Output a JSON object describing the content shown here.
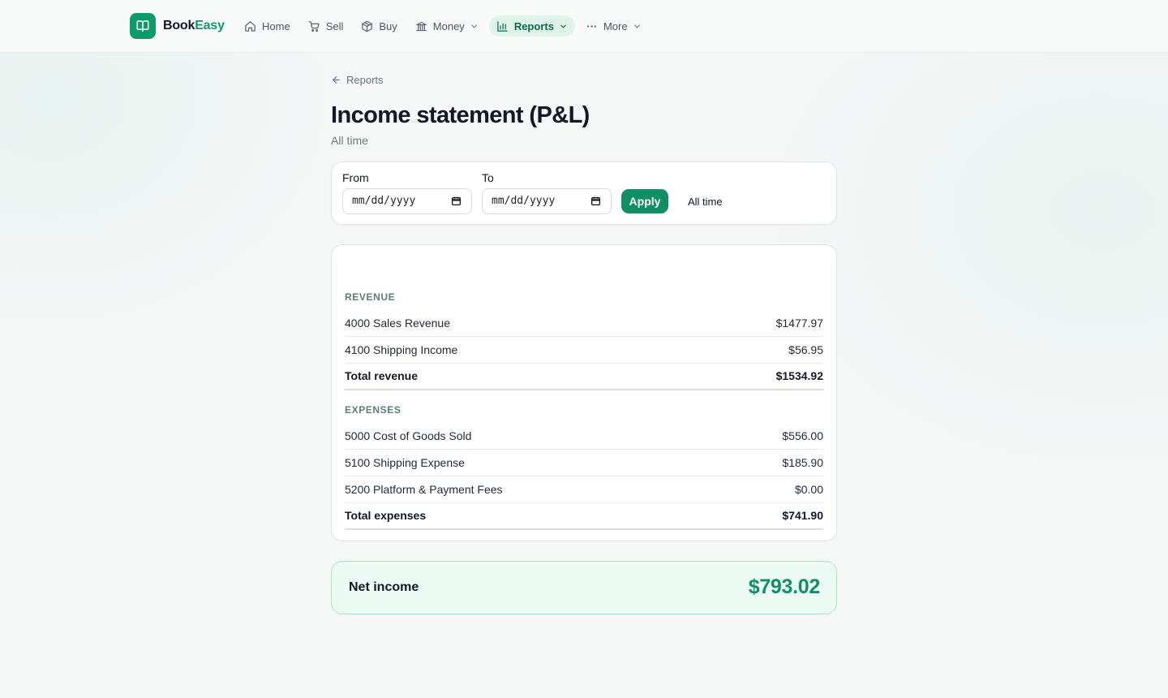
{
  "app": {
    "brand_prefix": "Book",
    "brand_accent": "Easy",
    "accent_color": "#0f9a6c"
  },
  "nav": {
    "items": [
      {
        "label": "Home",
        "icon": "home-icon"
      },
      {
        "label": "Sell",
        "icon": "cart-icon"
      },
      {
        "label": "Buy",
        "icon": "box-icon"
      },
      {
        "label": "Money",
        "icon": "bank-icon",
        "has_dropdown": true
      },
      {
        "label": "Reports",
        "icon": "bar-chart-icon",
        "has_dropdown": true,
        "active": true
      },
      {
        "label": "More",
        "icon": "ellipsis-icon",
        "has_dropdown": true
      }
    ]
  },
  "page": {
    "back_label": "Reports",
    "title": "Income statement (P&L)",
    "subtitle": "All time"
  },
  "filter": {
    "from_label": "From",
    "to_label": "To",
    "from_placeholder": "mm/dd/yyyy",
    "to_placeholder": "mm/dd/yyyy",
    "apply_label": "Apply",
    "range_label": "All time"
  },
  "statement": {
    "revenue": {
      "heading": "REVENUE",
      "rows": [
        {
          "label": "4000 Sales Revenue",
          "amount": "$1477.97"
        },
        {
          "label": "4100 Shipping Income",
          "amount": "$56.95"
        }
      ],
      "total_label": "Total revenue",
      "total_amount": "$1534.92"
    },
    "expenses": {
      "heading": "EXPENSES",
      "rows": [
        {
          "label": "5000 Cost of Goods Sold",
          "amount": "$556.00"
        },
        {
          "label": "5100 Shipping Expense",
          "amount": "$185.90"
        },
        {
          "label": "5200 Platform & Payment Fees",
          "amount": "$0.00"
        }
      ],
      "total_label": "Total expenses",
      "total_amount": "$741.90"
    }
  },
  "net_income": {
    "label": "Net income",
    "amount": "$793.02"
  }
}
